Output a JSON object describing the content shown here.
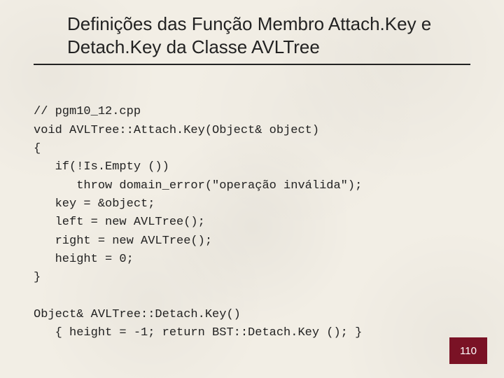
{
  "title": "Definições das Função Membro Attach.Key e Detach.Key da Classe AVLTree",
  "code": {
    "l1": "// pgm10_12.cpp",
    "l2": "void AVLTree::Attach.Key(Object& object)",
    "l3": "{",
    "l4": "   if(!Is.Empty ())",
    "l5": "      throw domain_error(\"operação inválida\");",
    "l6": "   key = &object;",
    "l7": "   left = new AVLTree();",
    "l8": "   right = new AVLTree();",
    "l9": "   height = 0;",
    "l10": "}",
    "l11": "",
    "l12": "Object& AVLTree::Detach.Key()",
    "l13": "   { height = -1; return BST::Detach.Key (); }"
  },
  "page_number": "110"
}
